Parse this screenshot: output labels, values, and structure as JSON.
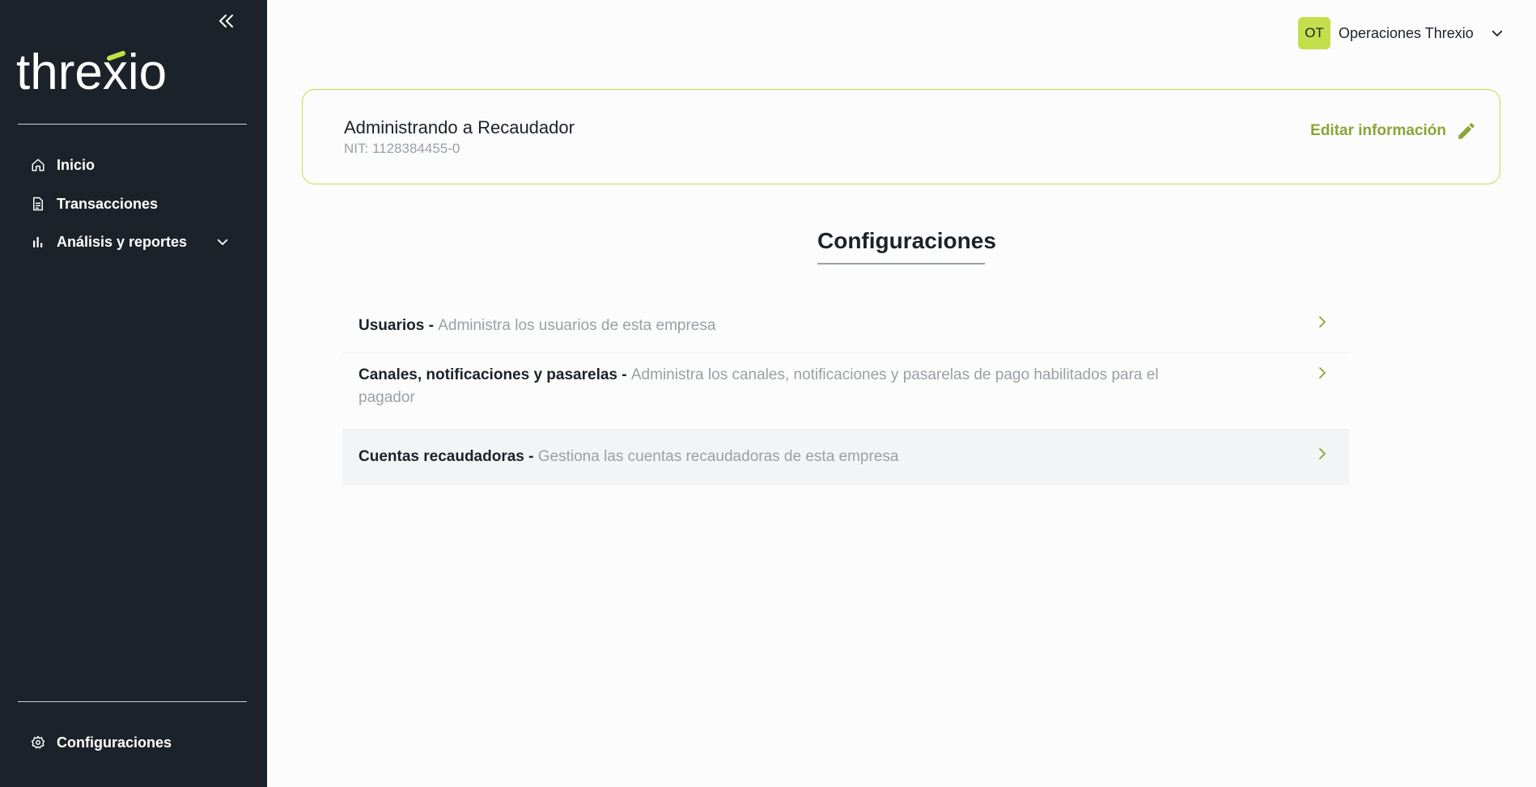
{
  "brand": {
    "logo_text_main": "threxio",
    "accent_color": "#c5de4c",
    "accent_text_color": "#8ba534",
    "sidebar_bg": "#1c2229"
  },
  "sidebar": {
    "collapse_icon": "double-chevron-left-icon",
    "items": [
      {
        "label": "Inicio",
        "icon": "home-icon"
      },
      {
        "label": "Transacciones",
        "icon": "document-icon"
      },
      {
        "label": "Análisis y reportes",
        "icon": "bar-chart-icon",
        "expand_icon": "chevron-down-icon"
      }
    ],
    "footer_item": {
      "label": "Configuraciones",
      "icon": "gear-icon"
    }
  },
  "header": {
    "user": {
      "initials": "OT",
      "name": "Operaciones Threxio",
      "menu_icon": "chevron-down-icon"
    }
  },
  "company": {
    "title": "Administrando a Recaudador",
    "nit": "NIT: 1128384455-0",
    "edit_label": "Editar información",
    "edit_icon": "pencil-icon"
  },
  "main": {
    "section_title": "Configuraciones",
    "config_items": [
      {
        "title": "Usuarios - ",
        "description": "Administra los usuarios de esta empresa"
      },
      {
        "title": "Canales, notificaciones y pasarelas - ",
        "description": "Administra los canales, notificaciones y pasarelas de pago habilitados para el pagador"
      },
      {
        "title": "Cuentas recaudadoras - ",
        "description": "Gestiona las cuentas recaudadoras de esta empresa"
      }
    ]
  }
}
